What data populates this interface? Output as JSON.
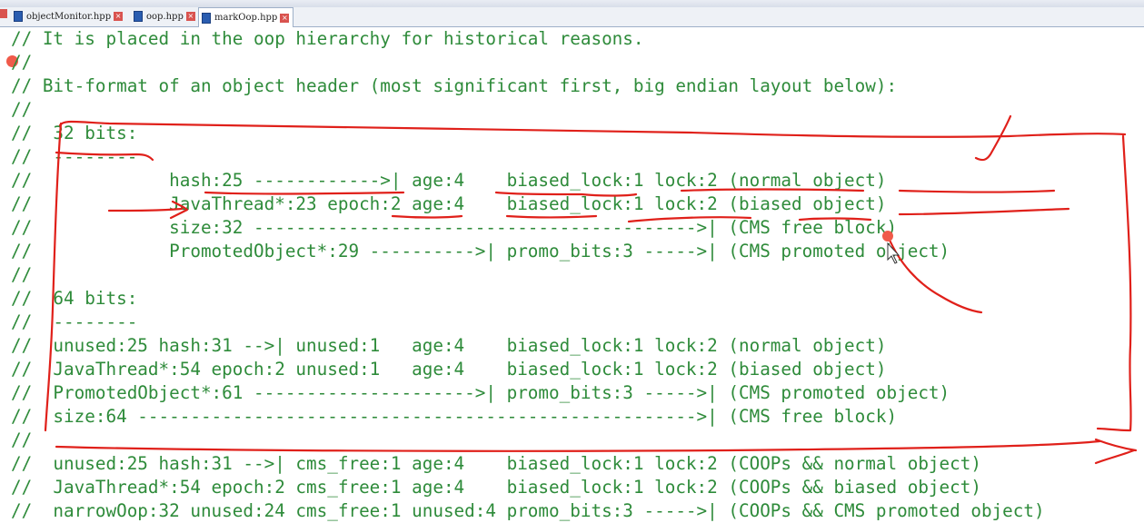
{
  "tabs": [
    {
      "label": "objectMonitor.hpp",
      "active": false
    },
    {
      "label": "oop.hpp",
      "active": false
    },
    {
      "label": "markOop.hpp",
      "active": true
    }
  ],
  "code_color": "#2e8b3a",
  "annotation_color": "#e0201a",
  "code_lines": [
    "// It is placed in the oop hierarchy for historical reasons.",
    "//",
    "// Bit-format of an object header (most significant first, big endian layout below):",
    "//",
    "//  32 bits:",
    "//  --------",
    "//             hash:25 ------------>| age:4    biased_lock:1 lock:2 (normal object)",
    "//             JavaThread*:23 epoch:2 age:4    biased_lock:1 lock:2 (biased object)",
    "//             size:32 ------------------------------------------>| (CMS free block)",
    "//             PromotedObject*:29 ---------->| promo_bits:3 ----->| (CMS promoted object)",
    "//",
    "//  64 bits:",
    "//  --------",
    "//  unused:25 hash:31 -->| unused:1   age:4    biased_lock:1 lock:2 (normal object)",
    "//  JavaThread*:54 epoch:2 unused:1   age:4    biased_lock:1 lock:2 (biased object)",
    "//  PromotedObject*:61 --------------------->| promo_bits:3 ----->| (CMS promoted object)",
    "//  size:64 ----------------------------------------------------->| (CMS free block)",
    "//",
    "//  unused:25 hash:31 -->| cms_free:1 age:4    biased_lock:1 lock:2 (COOPs && normal object)",
    "//  JavaThread*:54 epoch:2 cms_free:1 age:4    biased_lock:1 lock:2 (COOPs && biased object)",
    "//  narrowOop:32 unused:24 cms_free:1 unused:4 promo_bits:3 ----->| (COOPs && CMS promoted object)"
  ]
}
